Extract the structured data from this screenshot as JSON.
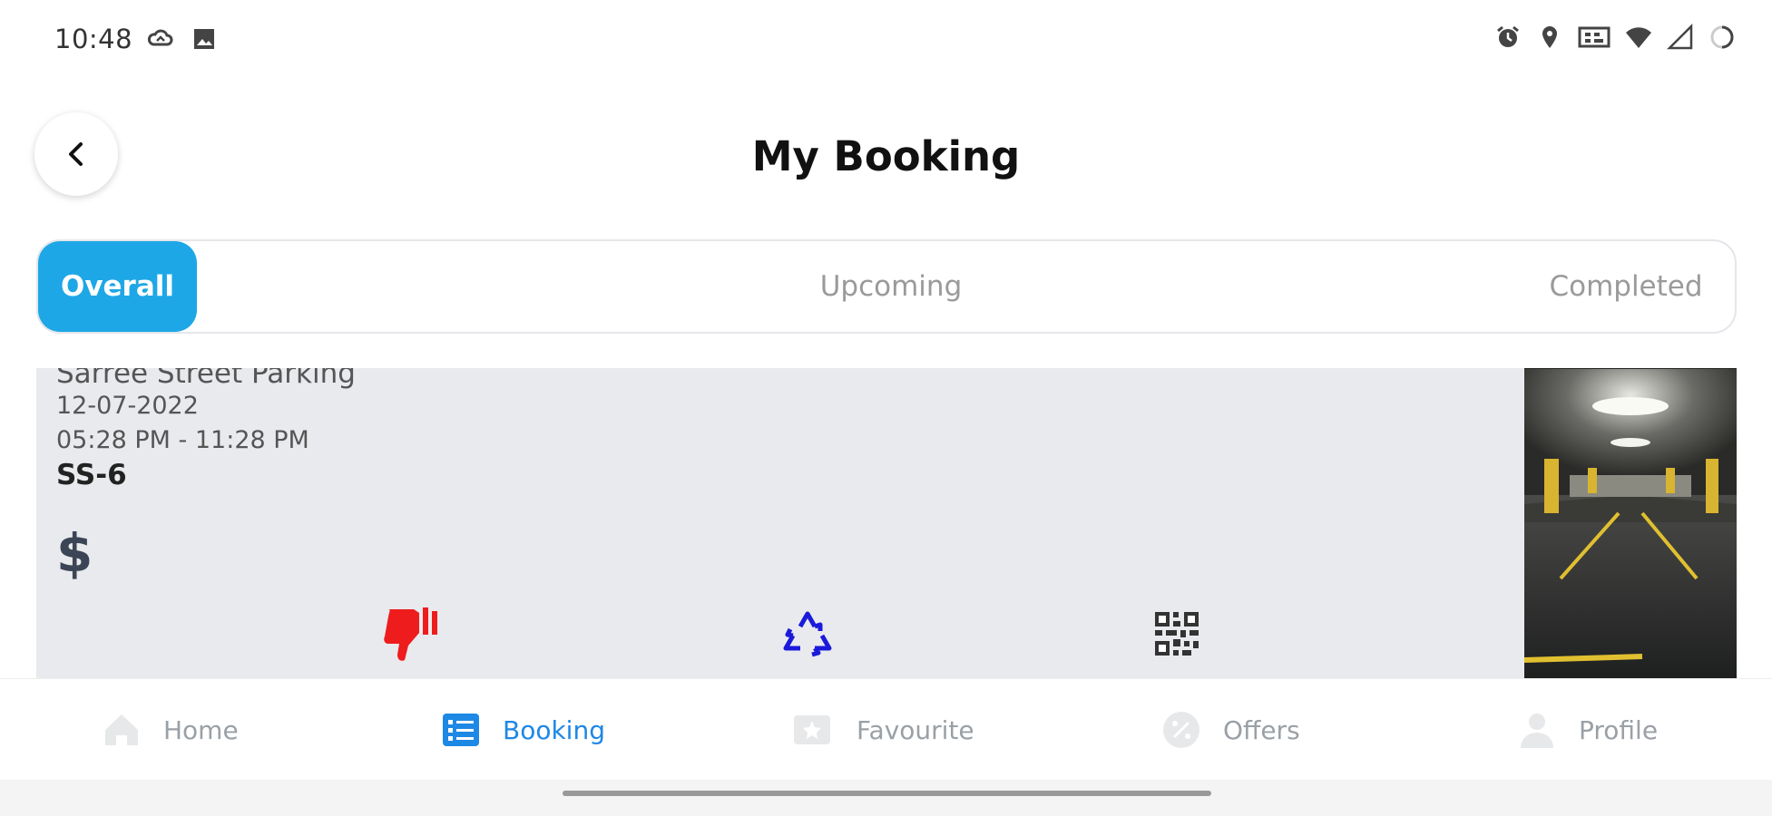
{
  "status_bar": {
    "time": "10:48",
    "left_icons": [
      "cloud-sync-icon",
      "image-icon"
    ],
    "right_icons": [
      "alarm-icon",
      "location-icon",
      "vibrate-icon",
      "wifi-icon",
      "signal-icon",
      "battery-icon"
    ]
  },
  "header": {
    "title": "My Booking",
    "back_icon": "chevron-left-icon"
  },
  "tabs": [
    {
      "label": "Overall",
      "active": true
    },
    {
      "label": "Upcoming",
      "active": false
    },
    {
      "label": "Completed",
      "active": false
    }
  ],
  "booking": {
    "name": "Sarree Street Parking",
    "date": "12-07-2022",
    "time_range": "05:28 PM - 11:28 PM",
    "slot": "SS-6",
    "price": "$",
    "actions": [
      "thumbs-down-icon",
      "recycle-icon",
      "qr-code-icon"
    ],
    "image": "parking-garage-photo"
  },
  "bottom_nav": [
    {
      "label": "Home",
      "icon": "home-icon",
      "active": false
    },
    {
      "label": "Booking",
      "icon": "booking-list-icon",
      "active": true
    },
    {
      "label": "Favourite",
      "icon": "favourite-icon",
      "active": false
    },
    {
      "label": "Offers",
      "icon": "offers-icon",
      "active": false
    },
    {
      "label": "Profile",
      "icon": "profile-icon",
      "active": false
    }
  ],
  "colors": {
    "accent": "#1ea7e6",
    "active_nav": "#1e88e5",
    "card_bg": "#e9eaee",
    "dislike": "#ee1c1c",
    "rebook": "#1a1adb"
  }
}
